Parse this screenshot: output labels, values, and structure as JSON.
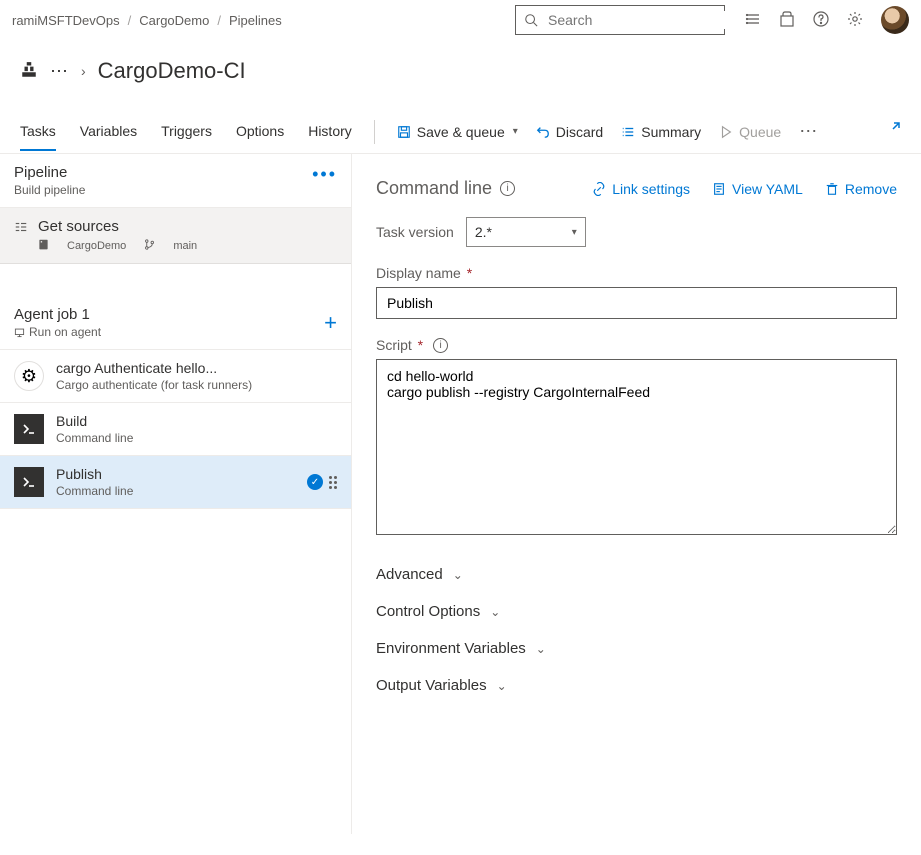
{
  "breadcrumb": {
    "org": "ramiMSFTDevOps",
    "project": "CargoDemo",
    "section": "Pipelines"
  },
  "search": {
    "placeholder": "Search"
  },
  "title": "CargoDemo-CI",
  "tabs": {
    "tasks": "Tasks",
    "variables": "Variables",
    "triggers": "Triggers",
    "options": "Options",
    "history": "History"
  },
  "actions": {
    "save_queue": "Save & queue",
    "discard": "Discard",
    "summary": "Summary",
    "queue": "Queue"
  },
  "pipeline": {
    "name": "Pipeline",
    "sub": "Build pipeline"
  },
  "sources": {
    "name": "Get sources",
    "repo": "CargoDemo",
    "branch": "main"
  },
  "job": {
    "name": "Agent job 1",
    "sub": "Run on agent"
  },
  "tasks_list": [
    {
      "name": "cargo Authenticate hello...",
      "sub": "Cargo authenticate (for task runners)"
    },
    {
      "name": "Build",
      "sub": "Command line"
    },
    {
      "name": "Publish",
      "sub": "Command line"
    }
  ],
  "panel": {
    "title": "Command line",
    "link_settings": "Link settings",
    "view_yaml": "View YAML",
    "remove": "Remove",
    "task_version_label": "Task version",
    "task_version_value": "2.*",
    "display_name_label": "Display name",
    "display_name_value": "Publish",
    "script_label": "Script",
    "script_value": "cd hello-world\ncargo publish --registry CargoInternalFeed",
    "advanced": "Advanced",
    "control_options": "Control Options",
    "env_vars": "Environment Variables",
    "output_vars": "Output Variables"
  }
}
